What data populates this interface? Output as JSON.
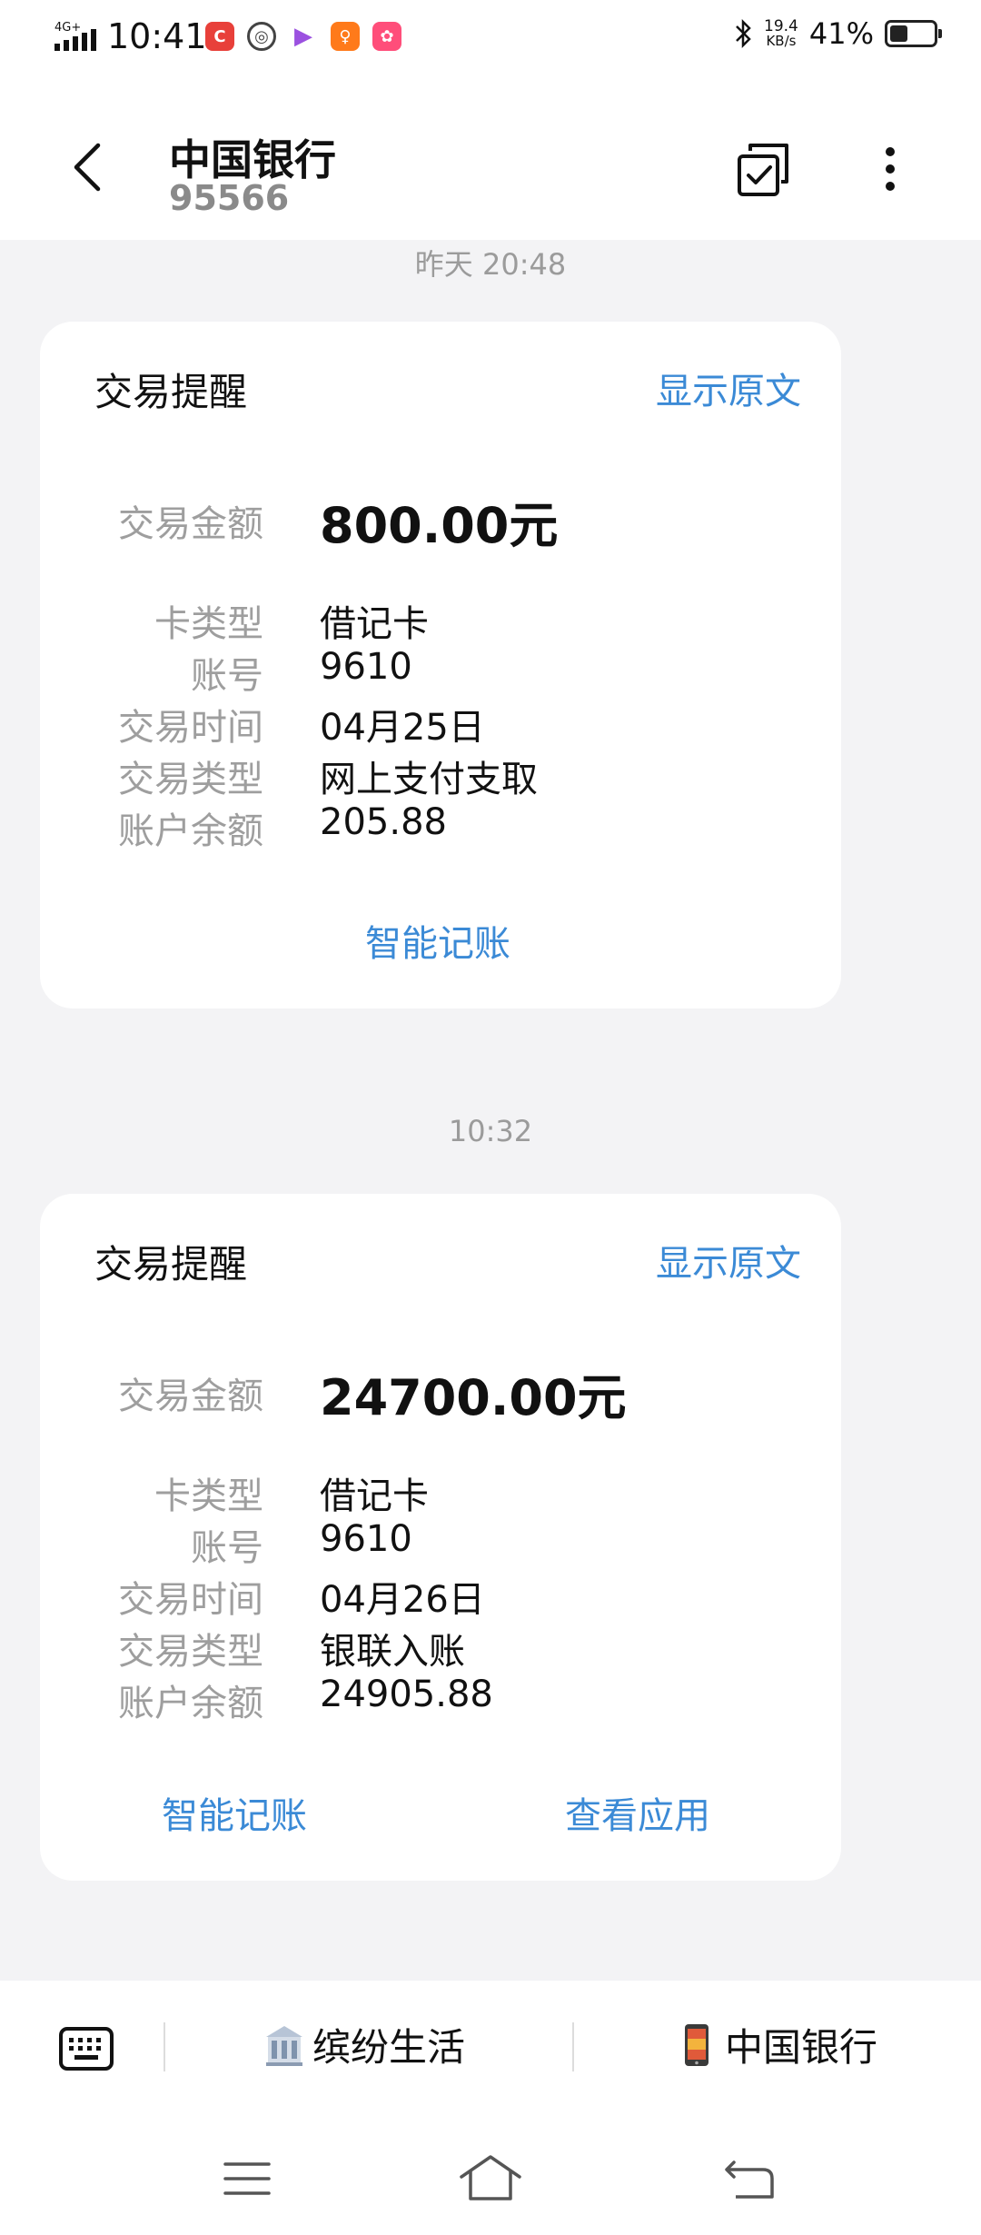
{
  "status_bar": {
    "network": "4G+",
    "time": "10:41",
    "speed_value": "19.4",
    "speed_unit": "KB/s",
    "battery_percent": "41%",
    "battery_level": 0.41,
    "app_icons": [
      {
        "name": "red-app-icon",
        "color": "#e8403a"
      },
      {
        "name": "circle-app-icon",
        "color": "#444444"
      },
      {
        "name": "video-app-icon",
        "color": "#9b51e0"
      },
      {
        "name": "orange-app-icon",
        "color": "#ff7a1a"
      },
      {
        "name": "pink-app-icon",
        "color": "#ff4e7a"
      }
    ]
  },
  "header": {
    "title": "中国银行",
    "subtitle": "95566"
  },
  "messages": [
    {
      "timestamp": "昨天 20:48",
      "card": {
        "title": "交易提醒",
        "show_original": "显示原文",
        "amount_label": "交易金额",
        "amount_value": "800.00元",
        "fields": [
          {
            "label": "卡类型",
            "value": "借记卡"
          },
          {
            "label": "账号",
            "value": "9610"
          },
          {
            "label": "交易时间",
            "value": "04月25日"
          },
          {
            "label": "交易类型",
            "value": "网上支付支取"
          },
          {
            "label": "账户余额",
            "value": "205.88"
          }
        ],
        "actions": [
          "智能记账"
        ]
      }
    },
    {
      "timestamp": "10:32",
      "card": {
        "title": "交易提醒",
        "show_original": "显示原文",
        "amount_label": "交易金额",
        "amount_value": "24700.00元",
        "fields": [
          {
            "label": "卡类型",
            "value": "借记卡"
          },
          {
            "label": "账号",
            "value": "9610"
          },
          {
            "label": "交易时间",
            "value": "04月26日"
          },
          {
            "label": "交易类型",
            "value": "银联入账"
          },
          {
            "label": "账户余额",
            "value": "24905.88"
          }
        ],
        "actions": [
          "智能记账",
          "查看应用"
        ]
      }
    }
  ],
  "bottom_menu": {
    "item1": "缤纷生活",
    "item2": "中国银行"
  },
  "colors": {
    "link": "#3b8ad6",
    "label_gray": "#9e9e9e",
    "background": "#f3f3f5"
  }
}
